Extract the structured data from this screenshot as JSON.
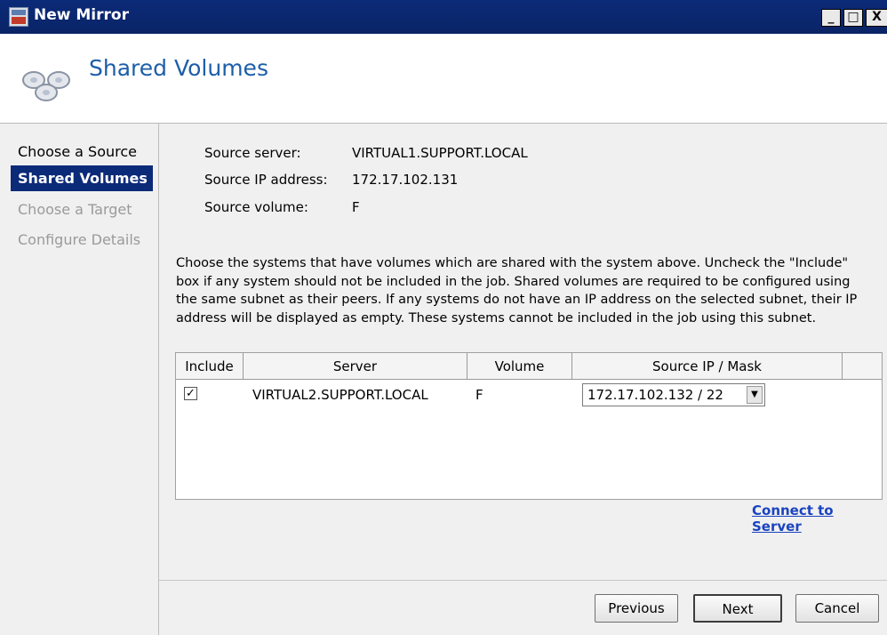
{
  "window": {
    "title": "New Mirror",
    "controls": {
      "minimize": "_",
      "maximize": "□",
      "close": "X"
    }
  },
  "header": {
    "title": "Shared Volumes"
  },
  "nav": {
    "items": [
      {
        "label": "Choose a Source",
        "state": "normal"
      },
      {
        "label": "Shared Volumes",
        "state": "selected"
      },
      {
        "label": "Choose a Target",
        "state": "disabled"
      },
      {
        "label": "Configure Details",
        "state": "disabled"
      }
    ]
  },
  "source": {
    "server_label": "Source server:",
    "server_value": "VIRTUAL1.SUPPORT.LOCAL",
    "ip_label": "Source IP address:",
    "ip_value": "172.17.102.131",
    "volume_label": "Source volume:",
    "volume_value": "F"
  },
  "description": "Choose the systems that have volumes which are shared with the system above. Uncheck the \"Include\" box if any system should not be included in the job. Shared volumes are required to be configured using the same subnet as their peers. If any systems do not have an IP address on the selected subnet, their IP address will be displayed as empty. These systems cannot be included in the job using this subnet.",
  "table": {
    "columns": [
      "Include",
      "Server",
      "Volume",
      "Source IP / Mask",
      ""
    ],
    "rows": [
      {
        "include": true,
        "check_glyph": "✓",
        "server": "VIRTUAL2.SUPPORT.LOCAL",
        "volume": "F",
        "ip_mask": "172.17.102.132 / 22",
        "arrow": "▼"
      }
    ]
  },
  "links": {
    "connect": "Connect to Server"
  },
  "buttons": {
    "previous": "Previous",
    "next": "Next",
    "cancel": "Cancel"
  },
  "colors": {
    "title_bar": "#0b2a78",
    "header_title": "#1d5ea8",
    "link": "#1a44c0",
    "nav_selected": "#0b2a78"
  }
}
